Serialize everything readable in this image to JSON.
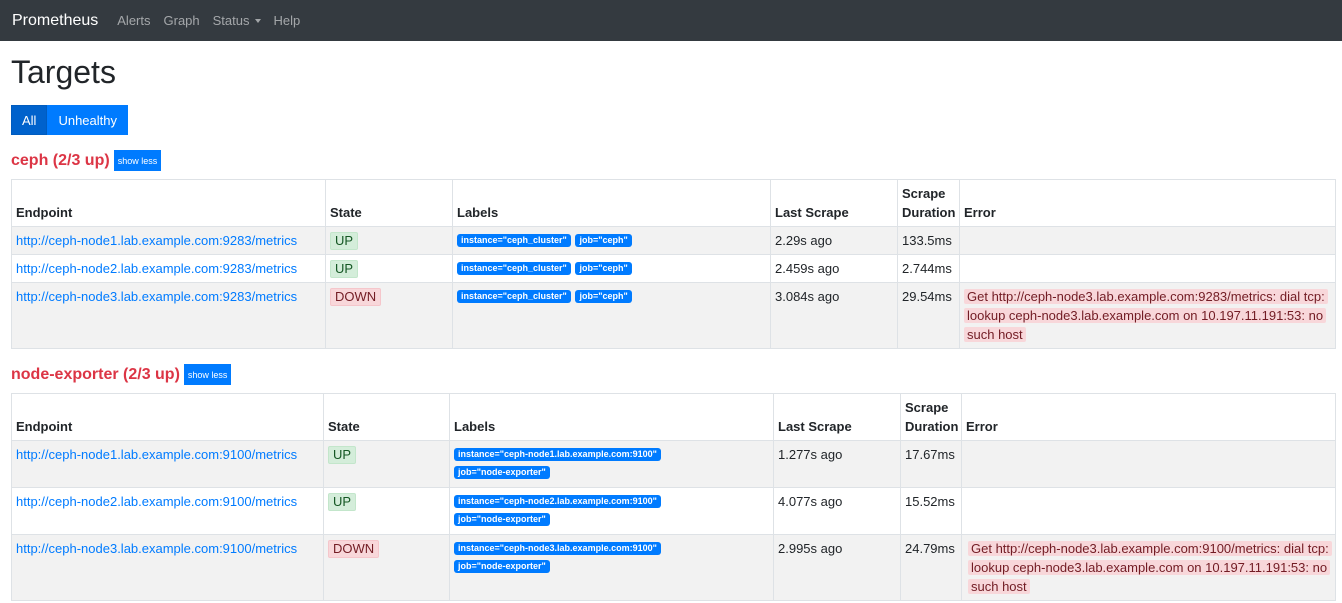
{
  "nav": {
    "brand": "Prometheus",
    "links": [
      "Alerts",
      "Graph",
      "Status",
      "Help"
    ]
  },
  "page": {
    "title": "Targets",
    "filter_all": "All",
    "filter_unhealthy": "Unhealthy",
    "show_less": "show less"
  },
  "columns": [
    "Endpoint",
    "State",
    "Labels",
    "Last Scrape",
    "Scrape Duration",
    "Error"
  ],
  "jobs": [
    {
      "title": "ceph (2/3 up)",
      "targets": [
        {
          "endpoint": "http://ceph-node1.lab.example.com:9283/metrics",
          "state": "UP",
          "labels": [
            "instance=\"ceph_cluster\"",
            "job=\"ceph\""
          ],
          "last_scrape": "2.29s ago",
          "duration": "133.5ms",
          "error": ""
        },
        {
          "endpoint": "http://ceph-node2.lab.example.com:9283/metrics",
          "state": "UP",
          "labels": [
            "instance=\"ceph_cluster\"",
            "job=\"ceph\""
          ],
          "last_scrape": "2.459s ago",
          "duration": "2.744ms",
          "error": ""
        },
        {
          "endpoint": "http://ceph-node3.lab.example.com:9283/metrics",
          "state": "DOWN",
          "labels": [
            "instance=\"ceph_cluster\"",
            "job=\"ceph\""
          ],
          "last_scrape": "3.084s ago",
          "duration": "29.54ms",
          "error": "Get http://ceph-node3.lab.example.com:9283/metrics: dial tcp: lookup ceph-node3.lab.example.com on 10.197.11.191:53: no such host"
        }
      ]
    },
    {
      "title": "node-exporter (2/3 up)",
      "targets": [
        {
          "endpoint": "http://ceph-node1.lab.example.com:9100/metrics",
          "state": "UP",
          "labels": [
            "instance=\"ceph-node1.lab.example.com:9100\"",
            "job=\"node-exporter\""
          ],
          "last_scrape": "1.277s ago",
          "duration": "17.67ms",
          "error": ""
        },
        {
          "endpoint": "http://ceph-node2.lab.example.com:9100/metrics",
          "state": "UP",
          "labels": [
            "instance=\"ceph-node2.lab.example.com:9100\"",
            "job=\"node-exporter\""
          ],
          "last_scrape": "4.077s ago",
          "duration": "15.52ms",
          "error": ""
        },
        {
          "endpoint": "http://ceph-node3.lab.example.com:9100/metrics",
          "state": "DOWN",
          "labels": [
            "instance=\"ceph-node3.lab.example.com:9100\"",
            "job=\"node-exporter\""
          ],
          "last_scrape": "2.995s ago",
          "duration": "24.79ms",
          "error": "Get http://ceph-node3.lab.example.com:9100/metrics: dial tcp: lookup ceph-node3.lab.example.com on 10.197.11.191:53: no such host"
        }
      ]
    }
  ]
}
